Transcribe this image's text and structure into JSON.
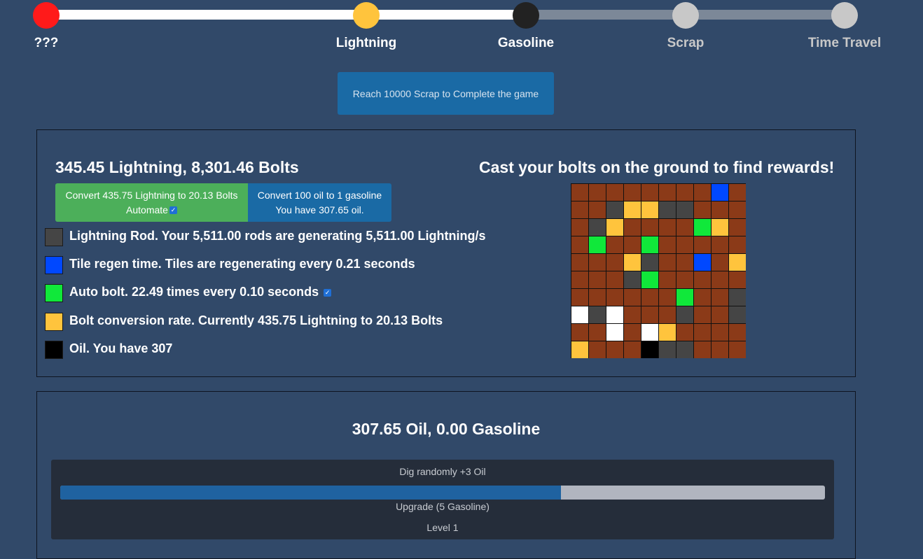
{
  "progress": {
    "stages": [
      {
        "label": "???",
        "node_color": "#ff1a1a",
        "label_color": "#ffffff"
      },
      {
        "label": "Lightning",
        "node_color": "#ffc43d",
        "label_color": "#ffffff"
      },
      {
        "label": "Gasoline",
        "node_color": "#222222",
        "label_color": "#ffffff"
      },
      {
        "label": "Scrap",
        "node_color": "#c8c8c8",
        "label_color": "#c8c8c8"
      },
      {
        "label": "Time Travel",
        "node_color": "#c8c8c8",
        "label_color": "#c8c8c8"
      }
    ],
    "completed_color": "#ffffff",
    "pending_color": "#7c8898"
  },
  "goal_button": "Reach 10000 Scrap to Complete the game",
  "lightning": {
    "header": "345.45 Lightning, 8,301.46 Bolts",
    "convert_button": {
      "line1": "Convert 435.75 Lightning to 20.13 Bolts",
      "line2": "Automate",
      "checked": true
    },
    "oil_button": {
      "line1": "Convert 100 oil to 1 gasoline",
      "line2": "You have 307.65 oil."
    },
    "upgrades": [
      {
        "color": "#454545",
        "text": "Lightning Rod. Your 5,511.00 rods are generating 5,511.00 Lightning/s",
        "checkbox": false
      },
      {
        "color": "#0048ff",
        "text": "Tile regen time. Tiles are regenerating every 0.21 seconds",
        "checkbox": false
      },
      {
        "color": "#10e83a",
        "text": "Auto bolt. 22.49 times every 0.10 seconds",
        "checkbox": true
      },
      {
        "color": "#ffc43d",
        "text": "Bolt conversion rate. Currently 435.75 Lightning to 20.13 Bolts",
        "checkbox": false
      },
      {
        "color": "#000000",
        "text": "Oil. You have 307",
        "checkbox": false
      }
    ],
    "cast_header": "Cast your bolts on the ground to find rewards!",
    "tile_colors": {
      "D": "#8b3a18",
      "G": "#454545",
      "Y": "#ffc43d",
      "E": "#10e83a",
      "B": "#0048ff",
      "W": "#ffffff",
      "K": "#000000"
    },
    "grid": [
      "DDDDDDDDBD",
      "DDGYYGGDDD",
      "DGYDDDDEYD",
      "DEDDEDDDDD",
      "DDDYGDDBDY",
      "DDDGEDDDDD",
      "DDDDDDEDDG",
      "WGWDDDGDDG",
      "DDWDWYDDDD",
      "YDDDKGGDDD"
    ]
  },
  "oil": {
    "header": "307.65 Oil, 0.00 Gasoline",
    "dig_title": "Dig randomly +3 Oil",
    "dig_progress": 0.655,
    "upgrade_label": "Upgrade (5 Gasoline)",
    "level_label": "Level 1"
  }
}
